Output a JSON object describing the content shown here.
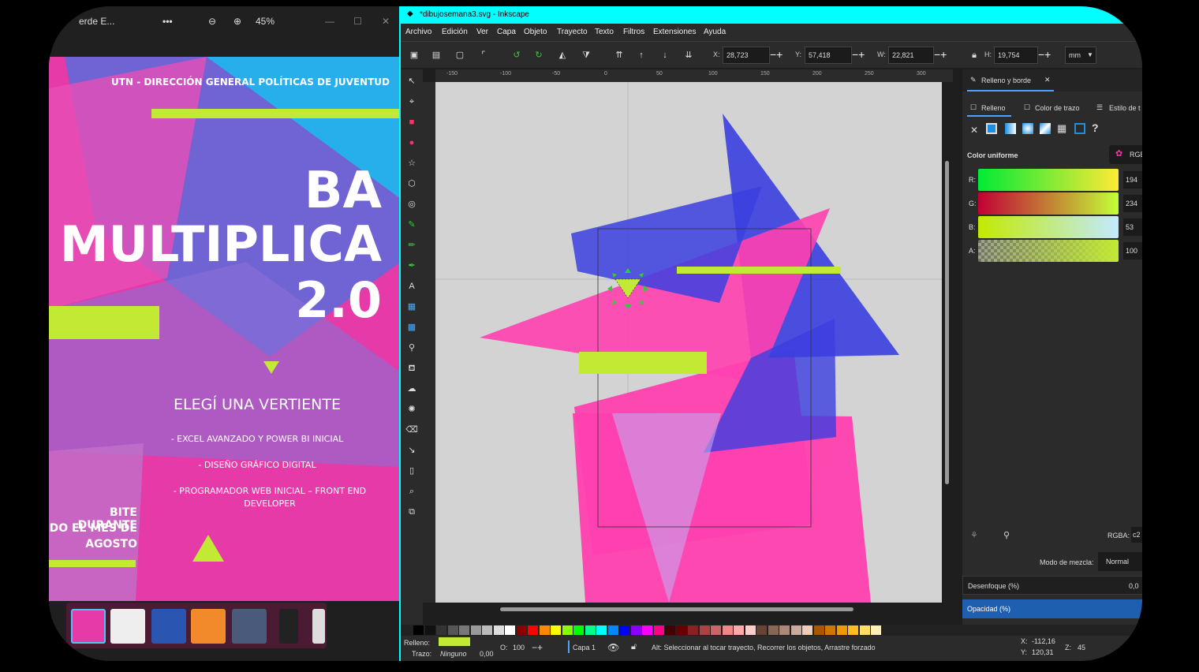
{
  "viewer": {
    "title": "erde E...",
    "more": "•••",
    "zoom": "45%",
    "poster": {
      "header": "UTN - DIRECCIÓN GENERAL POLÍTICAS DE JUVENTUD",
      "title_1": "BA",
      "title_2": "MULTIPLICA",
      "title_3": "2.0",
      "subtitle": "ELEGÍ UNA VERTIENTE",
      "items": [
        "- EXCEL AVANZADO Y POWER BI INICIAL",
        "- DISEÑO GRÁFICO DIGITAL",
        "- PROGRAMADOR WEB INICIAL – FRONT END",
        "DEVELOPER"
      ],
      "footer_1": "BITE DURANTE",
      "footer_2": "DO EL MES DE",
      "footer_3": "AGOSTO"
    }
  },
  "inkscape": {
    "title": "*dibujosemana3.svg - Inkscape",
    "menu": [
      "Archivo",
      "Edición",
      "Ver",
      "Capa",
      "Objeto",
      "Trayecto",
      "Texto",
      "Filtros",
      "Extensiones",
      "Ayuda"
    ],
    "coords": {
      "x_label": "X:",
      "x": "28,723",
      "y_label": "Y:",
      "y": "57,418",
      "w_label": "W:",
      "w": "22,821",
      "h_label": "H:",
      "h": "19,754",
      "unit": "mm"
    },
    "ruler": [
      "-150",
      "-100",
      "-50",
      "0",
      "50",
      "100",
      "150",
      "200",
      "250",
      "300"
    ],
    "panel": {
      "tab_title": "Relleno y borde",
      "tab_fill": "Relleno",
      "tab_stroke_color": "Color de trazo",
      "tab_stroke_style": "Estilo de t",
      "flat_color": "Color uniforme",
      "mode": "RGB",
      "r_label": "R:",
      "r": "194",
      "g_label": "G:",
      "g": "234",
      "b_label": "B:",
      "b": "53",
      "a_label": "A:",
      "a": "100",
      "rgba_label": "RGBA:",
      "rgba": "c2",
      "blend_label": "Modo de mezcla:",
      "blend": "Normal",
      "blur": "Desenfoque (%)",
      "blur_val": "0,0",
      "opacity": "Opacidad (%)"
    },
    "status": {
      "fill_label": "Relleno:",
      "stroke_label": "Trazo:",
      "stroke_val": "Ninguno",
      "stroke_width": "0,00",
      "opacity_label": "O:",
      "opacity": "100",
      "layer": "Capa 1",
      "hint": "Alt: Seleccionar al tocar trayecto, Recorrer los objetos, Arrastre forzado",
      "x_label": "X:",
      "x": "-112,16",
      "y_label": "Y:",
      "y": "120,31",
      "z_label": "Z:",
      "z": "45"
    },
    "colors": {
      "fill": "#c2ea35",
      "pink": "#ff40b0",
      "blue": "#3b3fe0",
      "accent": "#00ffff"
    }
  }
}
